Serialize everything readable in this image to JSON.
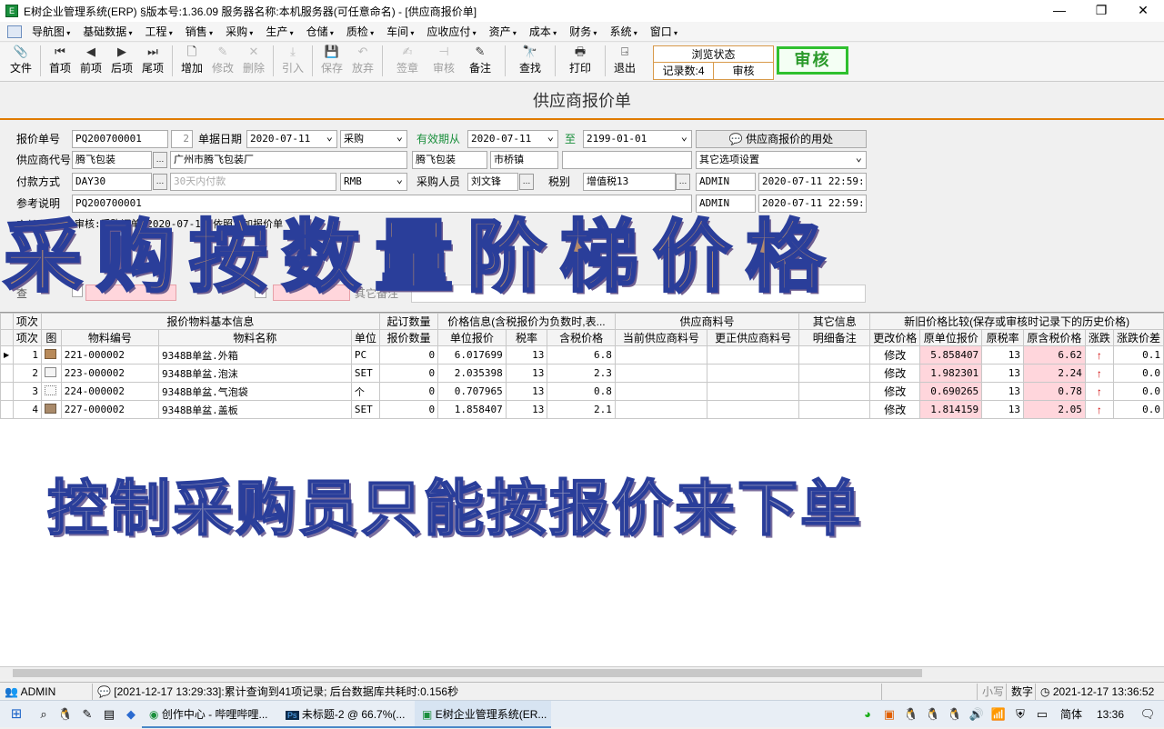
{
  "window": {
    "title": "E树企业管理系统(ERP) §版本号:1.36.09  服务器名称:本机服务器(可任意命名) - [供应商报价单]",
    "icon": "E",
    "minimize": "—",
    "restore": "❐",
    "close": "✕"
  },
  "menu": [
    "导航图",
    "基础数据",
    "工程",
    "销售",
    "采购",
    "生产",
    "仓储",
    "质检",
    "车间",
    "应收应付",
    "资产",
    "成本",
    "财务",
    "系统",
    "窗口"
  ],
  "toolbar": {
    "file": "文件",
    "first": "首项",
    "prev": "前项",
    "next": "后项",
    "last": "尾项",
    "add": "增加",
    "modify": "修改",
    "delete": "删除",
    "import": "引入",
    "save": "保存",
    "discard": "放弃",
    "sign": "签章",
    "audit": "审核",
    "remark": "备注",
    "find": "查找",
    "print": "打印",
    "exit": "退出",
    "icons": {
      "file": "📎",
      "first": "⏮",
      "prev": "◀",
      "next": "▶",
      "last": "⏭",
      "add": "🗋",
      "modify": "✎",
      "delete": "✕",
      "import": "⤓",
      "save": "💾",
      "discard": "↶",
      "sign": "✍",
      "audit": "⊣",
      "remark": "✎",
      "find": "🔭",
      "print": "🖶",
      "exit": "⍈"
    }
  },
  "browse_state": {
    "title": "浏览状态",
    "records": "记录数:4",
    "status": "审核"
  },
  "audit_button": "审核",
  "form_title": "供应商报价单",
  "form": {
    "quote_no_label": "报价单号",
    "quote_no": "PQ200700001",
    "seq": "2",
    "doc_date_label": "单据日期",
    "doc_date": "2020-07-11",
    "type": "采购",
    "valid_from_label": "有效期从",
    "valid_from": "2020-07-11",
    "to_label": "至",
    "valid_to": "2199-01-01",
    "usage_button": "供应商报价的用处",
    "supplier_code_label": "供应商代号",
    "supplier_code": "腾飞包装",
    "supplier_name": "广州市腾飞包装厂",
    "supplier_short": "腾飞包装",
    "town": "市桥镇",
    "other_options": "其它选项设置",
    "payment_label": "付款方式",
    "payment": "DAY30",
    "payment_placeholder": "30天内付款",
    "currency": "RMB",
    "buyer_label": "采购人员",
    "buyer": "刘文锋",
    "tax_label": "税别",
    "tax": "增值税13",
    "creator": "ADMIN",
    "created_at": "2020-07-11 22:59:15",
    "ref_label": "参考说明",
    "ref": "PQ200700001",
    "modifier": "ADMIN",
    "modified_at": "2020-07-11 22:59:15",
    "audit_info_label": "审核信息",
    "audit_info": "审核:采购订单  2020-07-11 依照增加报价单",
    "other_remark": "其它备注"
  },
  "grid": {
    "group_headers": [
      "项次",
      "报价物料基本信息",
      "起订数量",
      "价格信息(含税报价为负数时,表...",
      "供应商料号",
      "其它信息",
      "新旧价格比较(保存或审核时记录下的历史价格)"
    ],
    "columns": [
      "项次",
      "图",
      "物料编号",
      "物料名称",
      "单位",
      "报价数量",
      "单位报价",
      "税率",
      "含税价格",
      "当前供应商料号",
      "更正供应商料号",
      "明细备注",
      "更改价格",
      "原单位报价",
      "原税率",
      "原含税价格",
      "涨跌",
      "涨跌价差"
    ],
    "rows": [
      {
        "seq": "1",
        "code": "221-000002",
        "name": "9348B单盆.外箱",
        "unit": "PC",
        "qty": "0",
        "price": "6.017699",
        "tax": "13",
        "taxprice": "6.8",
        "change": "修改",
        "old_price": "5.858407",
        "old_tax": "13",
        "old_taxprice": "6.62",
        "trend": "↑",
        "diff": "0.1"
      },
      {
        "seq": "2",
        "code": "223-000002",
        "name": "9348B单盆.泡沫",
        "unit": "SET",
        "qty": "0",
        "price": "2.035398",
        "tax": "13",
        "taxprice": "2.3",
        "change": "修改",
        "old_price": "1.982301",
        "old_tax": "13",
        "old_taxprice": "2.24",
        "trend": "↑",
        "diff": "0.0"
      },
      {
        "seq": "3",
        "code": "224-000002",
        "name": "9348B单盆.气泡袋",
        "unit": "个",
        "qty": "0",
        "price": "0.707965",
        "tax": "13",
        "taxprice": "0.8",
        "change": "修改",
        "old_price": "0.690265",
        "old_tax": "13",
        "old_taxprice": "0.78",
        "trend": "↑",
        "diff": "0.0"
      },
      {
        "seq": "4",
        "code": "227-000002",
        "name": "9348B单盆.盖板",
        "unit": "SET",
        "qty": "0",
        "price": "1.858407",
        "tax": "13",
        "taxprice": "2.1",
        "change": "修改",
        "old_price": "1.814159",
        "old_tax": "13",
        "old_taxprice": "2.05",
        "trend": "↑",
        "diff": "0.0"
      }
    ]
  },
  "statusbar": {
    "user": "ADMIN",
    "message": "[2021-12-17 13:29:33]:累计查询到41项记录; 后台数据库共耗时:0.156秒",
    "caps": "小写",
    "numlock": "数字",
    "clock": "2021-12-17 13:36:52"
  },
  "taskbar": {
    "apps": [
      "创作中心 - 哔哩哔哩...",
      "未标题-2 @ 66.7%(...",
      "E树企业管理系统(ER..."
    ],
    "lang": "简体",
    "time": "13:36"
  },
  "overlay": {
    "line1": "采购按数量阶梯价格",
    "line2": "控制采购员只能按报价来下单"
  }
}
